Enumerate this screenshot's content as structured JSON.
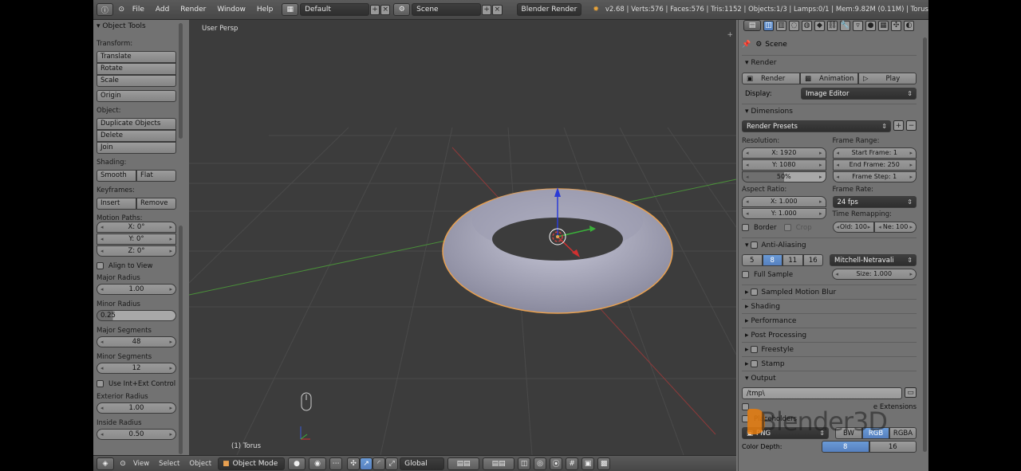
{
  "topbar": {
    "menus": [
      "File",
      "Add",
      "Render",
      "Window",
      "Help"
    ],
    "screen_layout": "Default",
    "scene": "Scene",
    "engine": "Blender Render",
    "stats": "v2.68 | Verts:576 | Faces:576 | Tris:1152 | Objects:1/3 | Lamps:0/1 | Mem:9.82M (0.11M) | Torus"
  },
  "tool_shelf": {
    "title": "Object Tools",
    "transform_label": "Transform:",
    "translate": "Translate",
    "rotate": "Rotate",
    "scale": "Scale",
    "origin": "Origin",
    "object_label": "Object:",
    "duplicate": "Duplicate Objects",
    "delete": "Delete",
    "join": "Join",
    "shading_label": "Shading:",
    "smooth": "Smooth",
    "flat": "Flat",
    "keyframes_label": "Keyframes:",
    "insert": "Insert",
    "remove": "Remove",
    "motion_paths_label": "Motion Paths:"
  },
  "operator_panel": {
    "rot_x": "X: 0°",
    "rot_y": "Y: 0°",
    "rot_z": "Z: 0°",
    "align_to_view": "Align to View",
    "major_radius_label": "Major Radius",
    "major_radius": "1.00",
    "minor_radius_label": "Minor Radius",
    "minor_radius": "0.25",
    "major_segments_label": "Major Segments",
    "major_segments": "48",
    "minor_segments_label": "Minor Segments",
    "minor_segments": "12",
    "use_int_ext": "Use Int+Ext Control",
    "exterior_radius_label": "Exterior Radius",
    "exterior_radius": "1.00",
    "inside_radius_label": "Inside Radius",
    "inside_radius": "0.50"
  },
  "viewport": {
    "view_label": "User Persp",
    "object_label": "(1) Torus"
  },
  "bottombar": {
    "menus": [
      "View",
      "Select",
      "Object"
    ],
    "mode": "Object Mode",
    "orientation": "Global"
  },
  "properties": {
    "scene_label": "Scene",
    "render_section": "Render",
    "render_btn": "Render",
    "animation_btn": "Animation",
    "play_btn": "Play",
    "display_label": "Display:",
    "display_value": "Image Editor",
    "dimensions_section": "Dimensions",
    "render_presets": "Render Presets",
    "resolution_label": "Resolution:",
    "res_x": "X: 1920",
    "res_y": "Y: 1080",
    "res_pct": "50%",
    "frame_range_label": "Frame Range:",
    "start_frame": "Start Frame: 1",
    "end_frame": "End Frame: 250",
    "frame_step": "Frame Step: 1",
    "aspect_label": "Aspect Ratio:",
    "aspect_x": "X: 1.000",
    "aspect_y": "Y: 1.000",
    "frame_rate_label": "Frame Rate:",
    "frame_rate": "24 fps",
    "time_remap_label": "Time Remapping:",
    "border": "Border",
    "crop": "Crop",
    "old": "Old: 100",
    "new": "Ne: 100",
    "aa_section": "Anti-Aliasing",
    "aa_samples": [
      "5",
      "8",
      "11",
      "16"
    ],
    "aa_filter": "Mitchell-Netravali",
    "full_sample": "Full Sample",
    "size": "Size: 1.000",
    "collapsed_sections": [
      "Sampled Motion Blur",
      "Shading",
      "Performance",
      "Post Processing",
      "Freestyle",
      "Stamp"
    ],
    "output_section": "Output",
    "output_path": "/tmp\\",
    "placeholders": "Placeholders",
    "format": "PNG",
    "bw": "BW",
    "rgb": "RGB",
    "rgba": "RGBA",
    "color_depth_label": "Color Depth:",
    "depth_8": "8",
    "depth_16": "16",
    "overwrite_partial": "e Extensions"
  },
  "watermark": "Blender3D"
}
